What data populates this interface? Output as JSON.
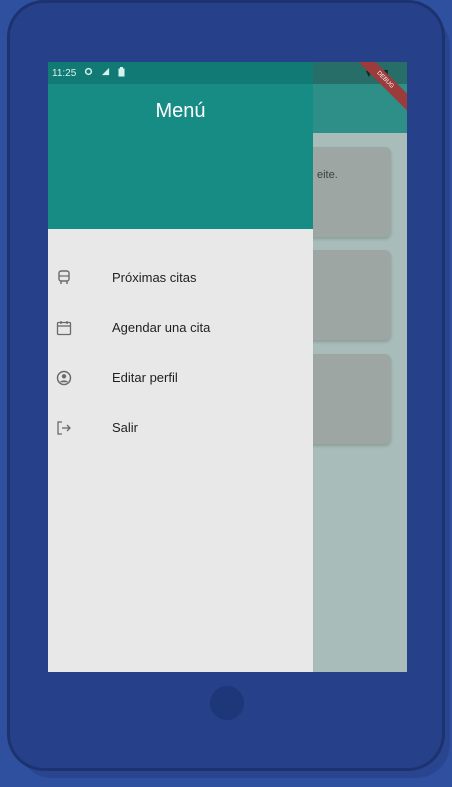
{
  "status_bar": {
    "time": "11:25",
    "left_icons": [
      "gear-icon",
      "signal-icon",
      "battery-saver-icon"
    ],
    "right_text": "▼▴ ▮"
  },
  "debug_banner": "DEBUG",
  "drawer": {
    "title": "Menú",
    "items": [
      {
        "label": "Próximas citas",
        "icon": "bus-icon"
      },
      {
        "label": "Agendar una cita",
        "icon": "calendar-icon"
      },
      {
        "label": "Editar perfil",
        "icon": "account-circle-icon"
      },
      {
        "label": "Salir",
        "icon": "logout-icon"
      }
    ]
  },
  "background": {
    "card_text": "eite."
  },
  "colors": {
    "primary": "#178c85",
    "drawer_bg": "#e8e8e8",
    "device": "#26408a"
  }
}
